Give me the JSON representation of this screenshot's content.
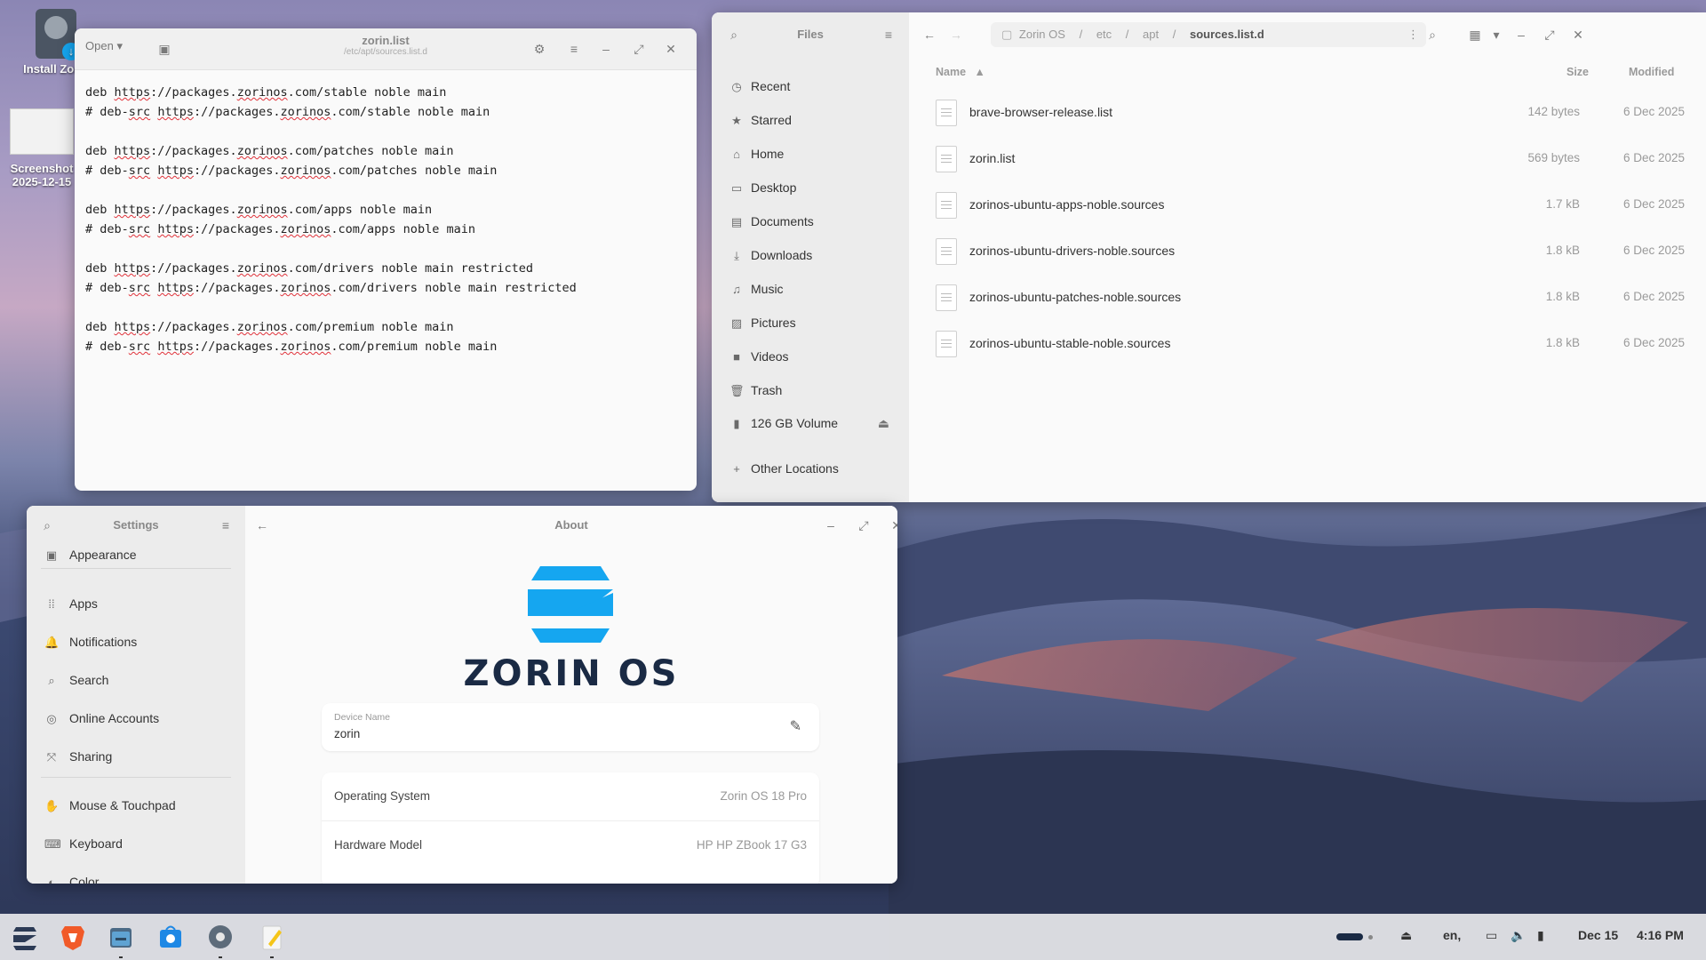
{
  "desktop": {
    "icons": [
      {
        "label": "Install Zorin"
      },
      {
        "label": "Screenshot",
        "sublabel": "2025-12-15"
      }
    ]
  },
  "editor": {
    "open_label": "Open",
    "title": "zorin.list",
    "subtitle": "/etc/apt/sources.list.d",
    "lines": [
      "deb https://packages.zorinos.com/stable noble main",
      "# deb-src https://packages.zorinos.com/stable noble main",
      "",
      "deb https://packages.zorinos.com/patches noble main",
      "# deb-src https://packages.zorinos.com/patches noble main",
      "",
      "deb https://packages.zorinos.com/apps noble main",
      "# deb-src https://packages.zorinos.com/apps noble main",
      "",
      "deb https://packages.zorinos.com/drivers noble main restricted",
      "# deb-src https://packages.zorinos.com/drivers noble main restricted",
      "",
      "deb https://packages.zorinos.com/premium noble main",
      "# deb-src https://packages.zorinos.com/premium noble main"
    ]
  },
  "files": {
    "title": "Files",
    "breadcrumb": [
      "Zorin OS",
      "etc",
      "apt",
      "sources.list.d"
    ],
    "sidebar": [
      {
        "label": "Recent",
        "icon": "clock-icon"
      },
      {
        "label": "Starred",
        "icon": "star-icon"
      },
      {
        "label": "Home",
        "icon": "home-icon"
      },
      {
        "label": "Desktop",
        "icon": "desktop-icon"
      },
      {
        "label": "Documents",
        "icon": "document-icon"
      },
      {
        "label": "Downloads",
        "icon": "download-icon"
      },
      {
        "label": "Music",
        "icon": "music-icon"
      },
      {
        "label": "Pictures",
        "icon": "picture-icon"
      },
      {
        "label": "Videos",
        "icon": "video-icon"
      },
      {
        "label": "Trash",
        "icon": "trash-icon"
      }
    ],
    "volume": "126 GB Volume",
    "other_locations": "Other Locations",
    "columns": {
      "name": "Name",
      "size": "Size",
      "modified": "Modified"
    },
    "rows": [
      {
        "name": "brave-browser-release.list",
        "size": "142 bytes",
        "modified": "6 Dec 2025"
      },
      {
        "name": "zorin.list",
        "size": "569 bytes",
        "modified": "6 Dec 2025"
      },
      {
        "name": "zorinos-ubuntu-apps-noble.sources",
        "size": "1.7 kB",
        "modified": "6 Dec 2025"
      },
      {
        "name": "zorinos-ubuntu-drivers-noble.sources",
        "size": "1.8 kB",
        "modified": "6 Dec 2025"
      },
      {
        "name": "zorinos-ubuntu-patches-noble.sources",
        "size": "1.8 kB",
        "modified": "6 Dec 2025"
      },
      {
        "name": "zorinos-ubuntu-stable-noble.sources",
        "size": "1.8 kB",
        "modified": "6 Dec 2025"
      }
    ]
  },
  "settings": {
    "title": "Settings",
    "page_title": "About",
    "sidebar": [
      {
        "label": "Appearance"
      },
      {
        "label": "Apps"
      },
      {
        "label": "Notifications"
      },
      {
        "label": "Search"
      },
      {
        "label": "Online Accounts"
      },
      {
        "label": "Sharing"
      },
      {
        "label": "Mouse & Touchpad"
      },
      {
        "label": "Keyboard"
      },
      {
        "label": "Color"
      }
    ],
    "logo_text": "ZORIN OS",
    "device_name_label": "Device Name",
    "device_name": "zorin",
    "info": [
      {
        "label": "Operating System",
        "value": "Zorin OS 18 Pro"
      },
      {
        "label": "Hardware Model",
        "value": "HP HP ZBook 17 G3"
      }
    ]
  },
  "taskbar": {
    "lang": "en,",
    "date": "Dec 15",
    "time": "4:16 PM",
    "colors": {
      "zorin_blue": "#15a6f0",
      "brave_orange": "#f15a29"
    }
  }
}
